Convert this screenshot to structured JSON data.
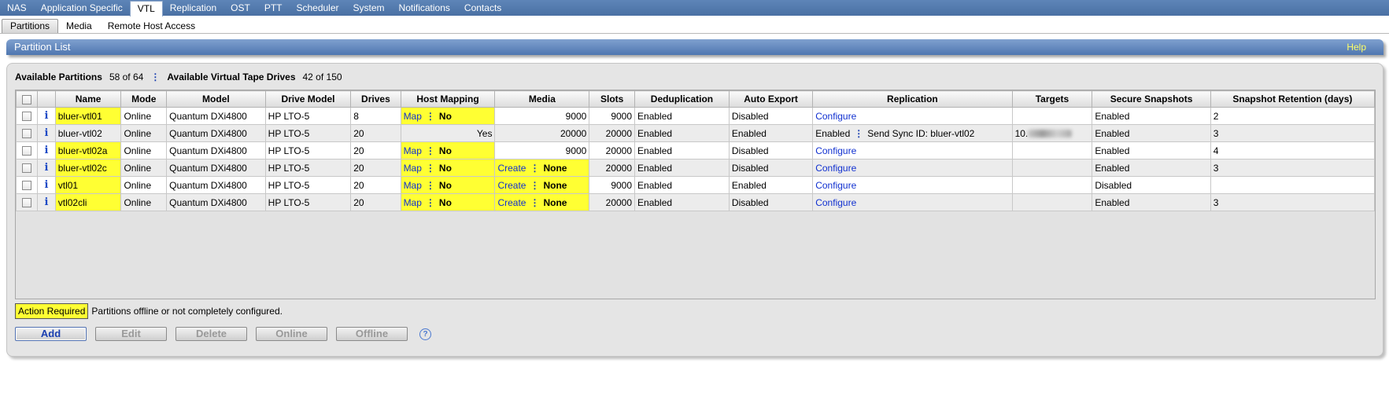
{
  "topnav": [
    "NAS",
    "Application Specific",
    "VTL",
    "Replication",
    "OST",
    "PTT",
    "Scheduler",
    "System",
    "Notifications",
    "Contacts"
  ],
  "subnav": [
    "Partitions",
    "Media",
    "Remote Host Access"
  ],
  "panel": {
    "title": "Partition List",
    "help": "Help"
  },
  "summary": {
    "partitions_label": "Available Partitions",
    "partitions_value": "58 of 64",
    "drives_label": "Available Virtual Tape Drives",
    "drives_value": "42 of 150"
  },
  "table": {
    "headers": [
      "Name",
      "Mode",
      "Model",
      "Drive Model",
      "Drives",
      "Host Mapping",
      "Media",
      "Slots",
      "Deduplication",
      "Auto Export",
      "Replication",
      "Targets",
      "Secure Snapshots",
      "Snapshot Retention (days)"
    ],
    "rows": [
      {
        "name": "bluer-vtl01",
        "mode": "Online",
        "model": "Quantum DXi4800",
        "drive_model": "HP LTO-5",
        "drives": "8",
        "map": "Map",
        "map_status": "No",
        "media": "9000",
        "slots": "9000",
        "dedup": "Enabled",
        "auto_export": "Disabled",
        "replication": "Configure",
        "targets": "",
        "secure": "Enabled",
        "retention": "2"
      },
      {
        "name": "bluer-vtl02",
        "mode": "Online",
        "model": "Quantum DXi4800",
        "drive_model": "HP LTO-5",
        "drives": "20",
        "host_value": "Yes",
        "media": "20000",
        "slots": "20000",
        "dedup": "Enabled",
        "auto_export": "Enabled",
        "replication_status": "Enabled",
        "replication_detail": "Send Sync ID: bluer-vtl02",
        "targets": "10.",
        "secure": "Enabled",
        "retention": "3"
      },
      {
        "name": "bluer-vtl02a",
        "mode": "Online",
        "model": "Quantum DXi4800",
        "drive_model": "HP LTO-5",
        "drives": "20",
        "map": "Map",
        "map_status": "No",
        "media": "9000",
        "slots": "20000",
        "dedup": "Enabled",
        "auto_export": "Disabled",
        "replication": "Configure",
        "targets": "",
        "secure": "Enabled",
        "retention": "4"
      },
      {
        "name": "bluer-vtl02c",
        "mode": "Online",
        "model": "Quantum DXi4800",
        "drive_model": "HP LTO-5",
        "drives": "20",
        "map": "Map",
        "map_status": "No",
        "create": "Create",
        "media_status": "None",
        "slots": "20000",
        "dedup": "Enabled",
        "auto_export": "Disabled",
        "replication": "Configure",
        "targets": "",
        "secure": "Enabled",
        "retention": "3"
      },
      {
        "name": "vtl01",
        "mode": "Online",
        "model": "Quantum DXi4800",
        "drive_model": "HP LTO-5",
        "drives": "20",
        "map": "Map",
        "map_status": "No",
        "create": "Create",
        "media_status": "None",
        "slots": "9000",
        "dedup": "Enabled",
        "auto_export": "Enabled",
        "replication": "Configure",
        "targets": "",
        "secure": "Disabled",
        "retention": ""
      },
      {
        "name": "vtl02cli",
        "mode": "Online",
        "model": "Quantum DXi4800",
        "drive_model": "HP LTO-5",
        "drives": "20",
        "map": "Map",
        "map_status": "No",
        "create": "Create",
        "media_status": "None",
        "slots": "20000",
        "dedup": "Enabled",
        "auto_export": "Disabled",
        "replication": "Configure",
        "targets": "",
        "secure": "Enabled",
        "retention": "3"
      }
    ]
  },
  "legend": {
    "swatch": "Action Required",
    "text": "Partitions offline or not completely configured."
  },
  "buttons": {
    "add": "Add",
    "edit": "Edit",
    "delete": "Delete",
    "online": "Online",
    "offline": "Offline",
    "help": "?"
  },
  "colors": {
    "highlight": "#ffff33",
    "nav": "#4a70a3",
    "link": "#1030d0"
  }
}
